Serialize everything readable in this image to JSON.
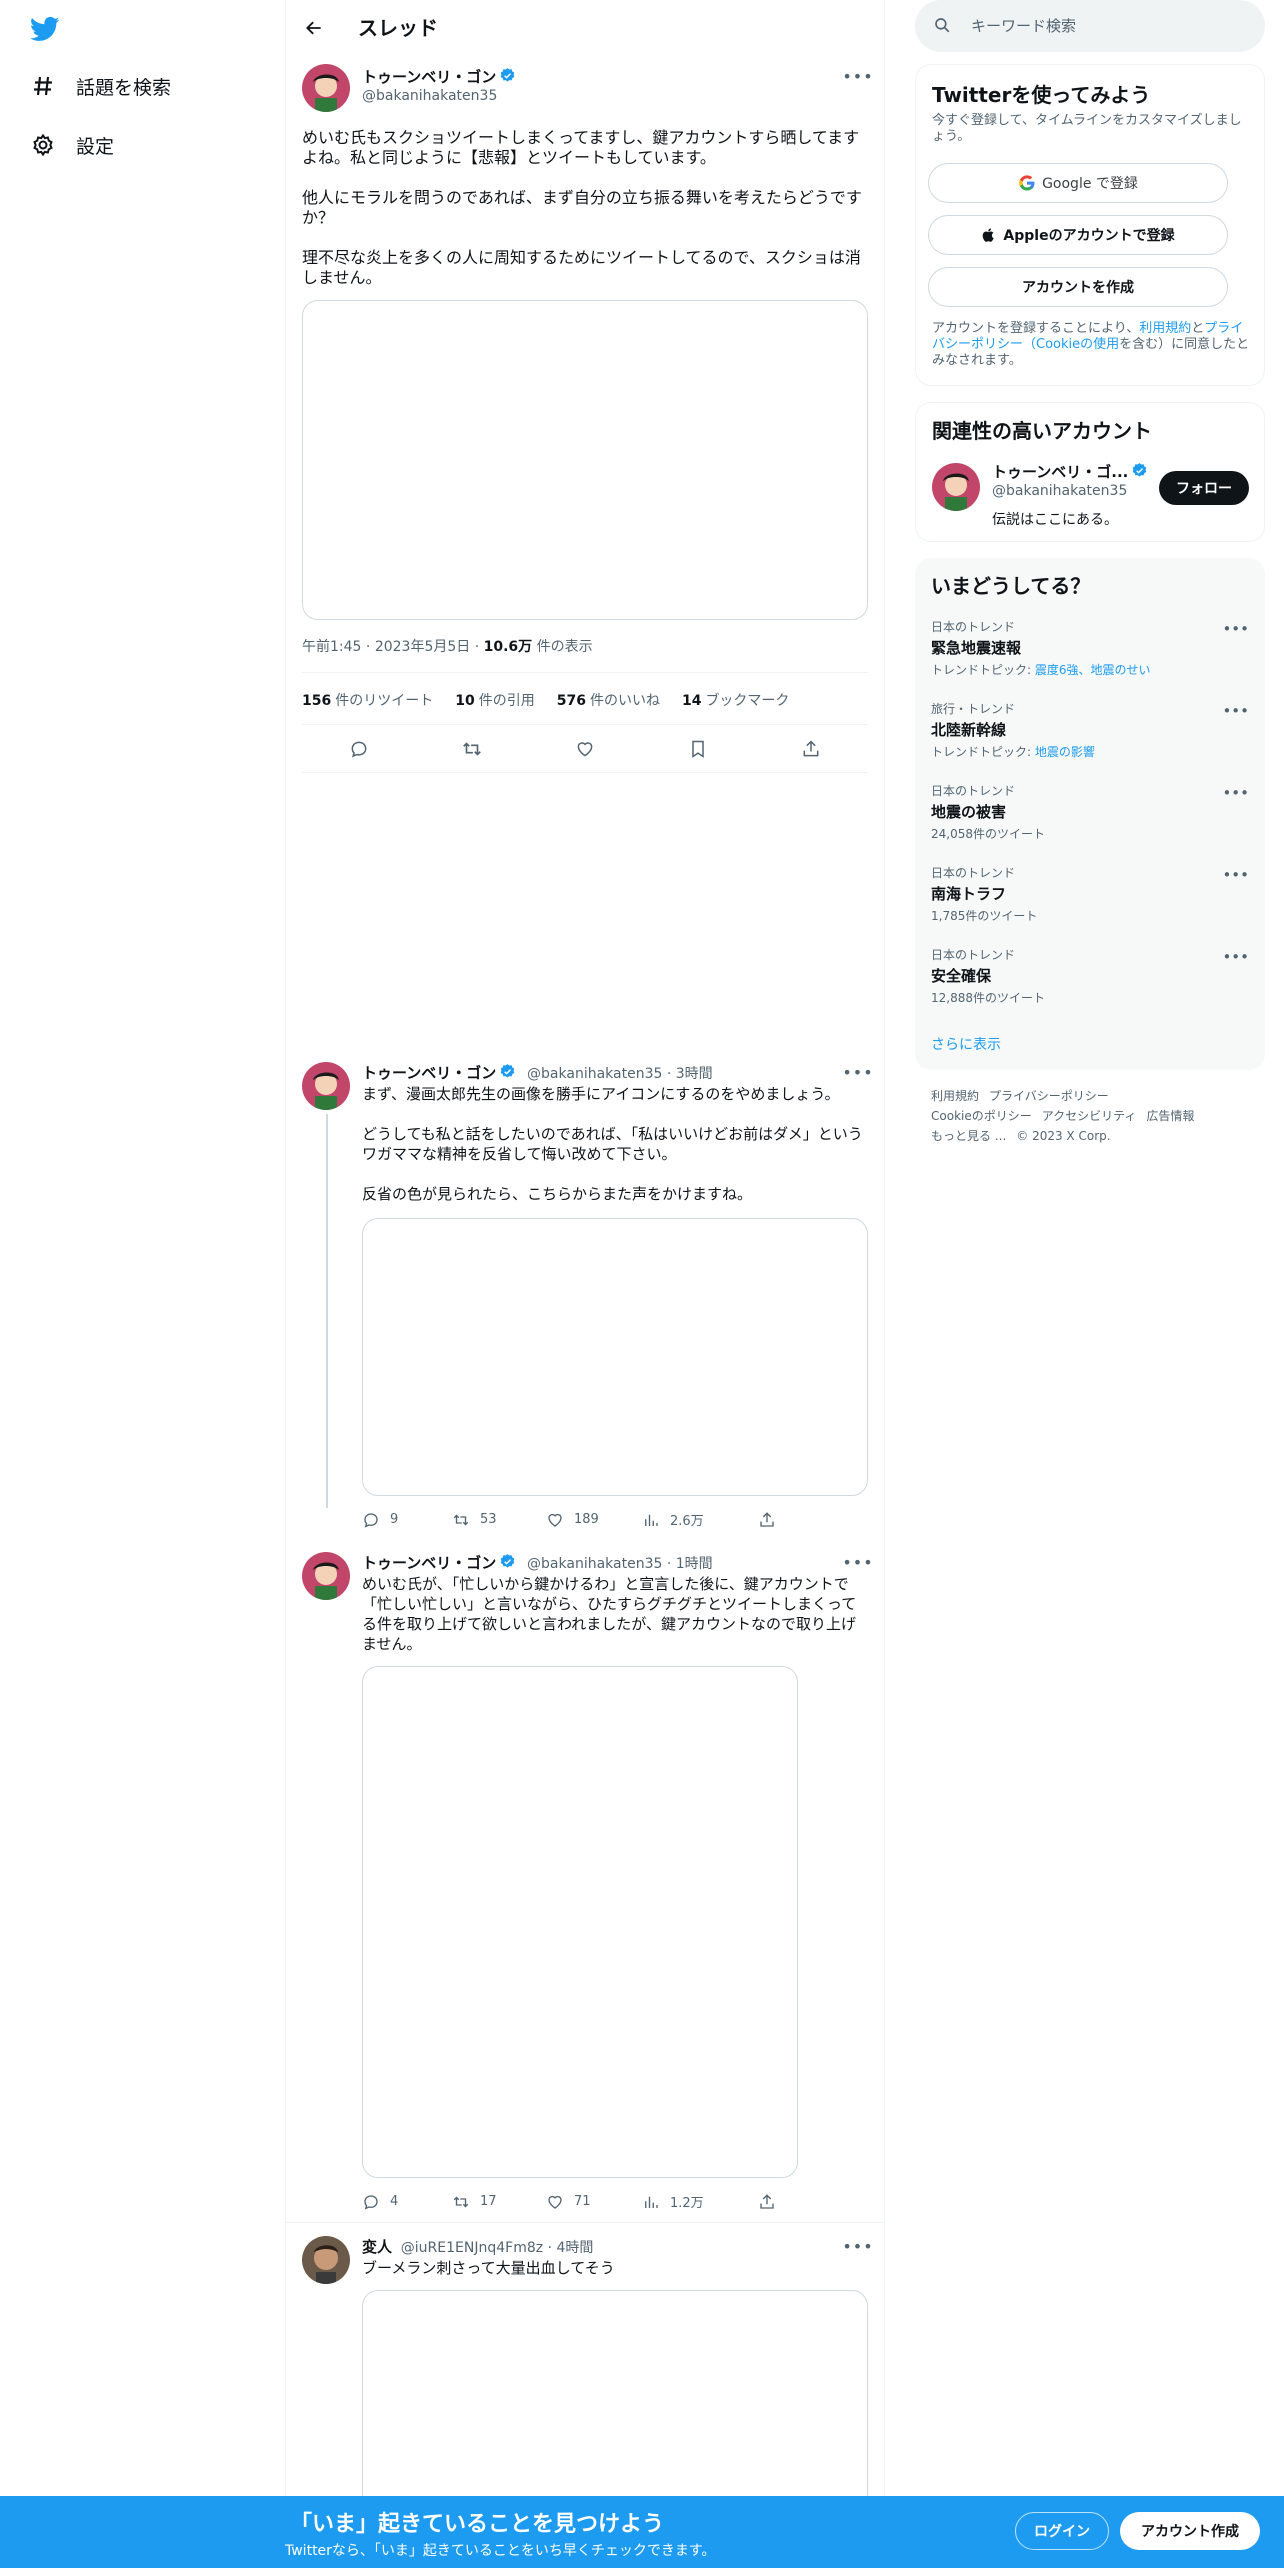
{
  "nav": {
    "explore_label": "話題を検索",
    "settings_label": "設定"
  },
  "header": {
    "title": "スレッド"
  },
  "main_tweet": {
    "author_name": "トゥーンベリ・ゴン",
    "handle": "@bakanihakaten35",
    "paragraph_1": "めいむ氏もスクショツイートしまくってますし、鍵アカウントすら晒してますよね。私と同じように【悲報】とツイートもしています。",
    "paragraph_2": "他人にモラルを問うのであれば、まず自分の立ち振る舞いを考えたらどうですか？",
    "paragraph_3": "理不尽な炎上を多くの人に周知するためにツイートしてるので、スクショは消しません。",
    "time": "午前1:45",
    "date": "2023年5月5日",
    "views_count": "10.6万",
    "views_label": "件の表示",
    "retweets_count": "156",
    "retweets_label": "件のリツイート",
    "quotes_count": "10",
    "quotes_label": "件の引用",
    "likes_count": "576",
    "likes_label": "件のいいね",
    "bookmarks_count": "14",
    "bookmarks_label": "ブックマーク"
  },
  "replies": [
    {
      "author_name": "トゥーンベリ・ゴン",
      "handle": "@bakanihakaten35",
      "time": "3時間",
      "paragraph_1": "まず、漫画太郎先生の画像を勝手にアイコンにするのをやめましょう。",
      "paragraph_2": "どうしても私と話をしたいのであれば、「私はいいけどお前はダメ」というワガママな精神を反省して悔い改めて下さい。",
      "paragraph_3": "反省の色が見られたら、こちらからまた声をかけますね。",
      "reply_count": "9",
      "retweet_count": "53",
      "like_count": "189",
      "view_count": "2.6万"
    },
    {
      "author_name": "トゥーンベリ・ゴン",
      "handle": "@bakanihakaten35",
      "time": "1時間",
      "paragraph_1": "めいむ氏が、「忙しいから鍵かけるわ」と宣言した後に、鍵アカウントで「忙しい忙しい」と言いながら、ひたすらグチグチとツイートしまくってる件を取り上げて欲しいと言われましたが、鍵アカウントなので取り上げません。",
      "reply_count": "4",
      "retweet_count": "17",
      "like_count": "71",
      "view_count": "1.2万"
    },
    {
      "author_name": "変人",
      "handle": "@iuRE1ENJnq4Fm8z",
      "time": "4時間",
      "paragraph_1": "ブーメラン刺さって大量出血してそう"
    }
  ],
  "search": {
    "placeholder": "キーワード検索"
  },
  "signup_card": {
    "title": "Twitterを使ってみよう",
    "subtitle": "今すぐ登録して、タイムラインをカスタマイズしましょう。",
    "google_button": "Google で登録",
    "apple_button": "Appleのアカウントで登録",
    "create_button": "アカウントを作成",
    "legal_1": "アカウントを登録することにより、",
    "legal_terms": "利用規約",
    "legal_and": "と",
    "legal_privacy": "プライバシーポリシー（Cookieの使用",
    "legal_2": "を含む）に同意したとみなされます。"
  },
  "related_card": {
    "title": "関連性の高いアカウント",
    "name": "トゥーンベリ・ゴ...",
    "handle": "@bakanihakaten35",
    "bio": "伝説はここにある。",
    "follow_button": "フォロー"
  },
  "trends_card": {
    "title": "いまどうしてる？",
    "items": [
      {
        "category": "日本のトレンド",
        "title": "緊急地震速報",
        "sub_prefix": "トレンドトピック: ",
        "sub_links": "震度6強、地震のせい"
      },
      {
        "category": "旅行・トレンド",
        "title": "北陸新幹線",
        "sub_prefix": "トレンドトピック: ",
        "sub_links": "地震の影響"
      },
      {
        "category": "日本のトレンド",
        "title": "地震の被害",
        "sub": "24,058件のツイート"
      },
      {
        "category": "日本のトレンド",
        "title": "南海トラフ",
        "sub": "1,785件のツイート"
      },
      {
        "category": "日本のトレンド",
        "title": "安全確保",
        "sub": "12,888件のツイート"
      }
    ],
    "show_more": "さらに表示"
  },
  "footer": {
    "terms": "利用規約",
    "privacy": "プライバシーポリシー",
    "cookie": "Cookieのポリシー",
    "accessibility": "アクセシビリティ",
    "ads": "広告情報",
    "more": "もっと見る ...",
    "copyright": "© 2023 X Corp."
  },
  "bottom_bar": {
    "title": "「いま」起きていることを見つけよう",
    "subtitle": "Twitterなら、「いま」起きていることをいち早くチェックできます。",
    "login": "ログイン",
    "signup": "アカウント作成"
  },
  "colors": {
    "brand": "#1d9bf0",
    "text": "#0f1419",
    "secondary": "#536471",
    "border": "#eff3f4"
  },
  "icons": [
    "twitter-logo-icon",
    "hashtag-icon",
    "gear-icon",
    "back-arrow-icon",
    "verified-icon",
    "more-icon",
    "reply-icon",
    "retweet-icon",
    "like-icon",
    "bookmark-icon",
    "share-icon",
    "views-icon",
    "search-icon",
    "google-icon",
    "apple-icon"
  ]
}
